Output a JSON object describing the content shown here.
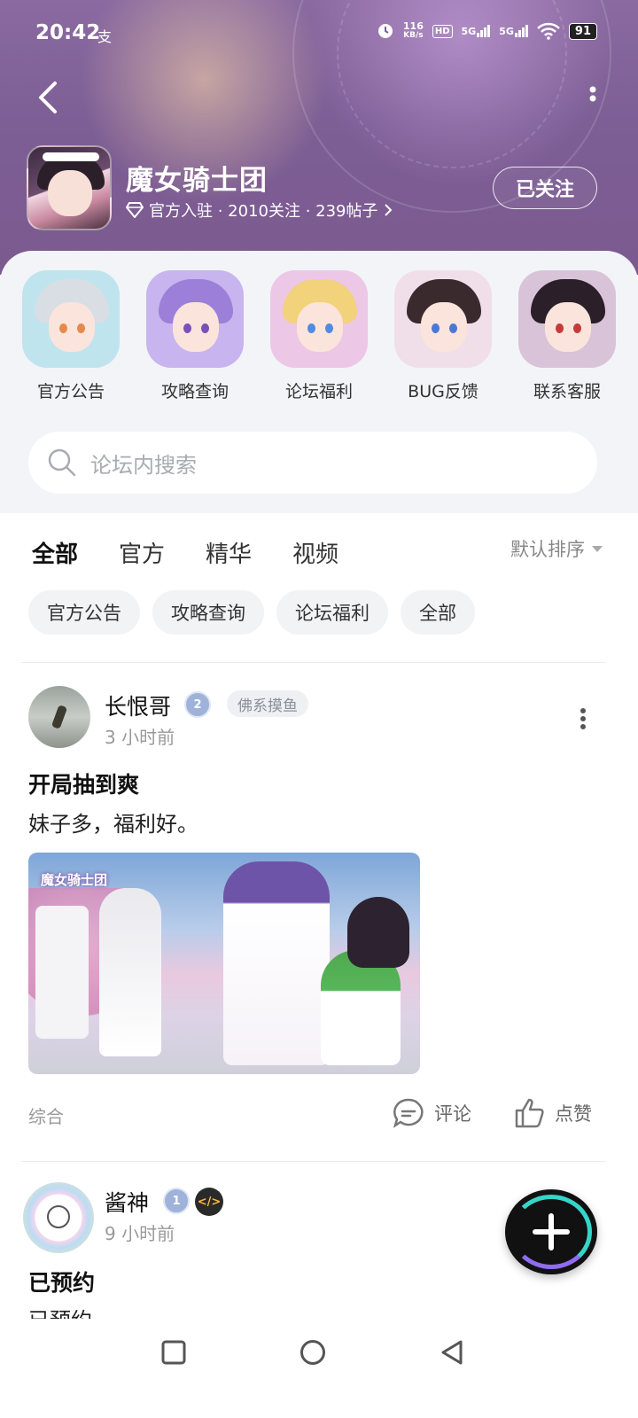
{
  "status_bar": {
    "time": "20:42",
    "extra": "支",
    "speed_value": "116",
    "speed_unit": "KB/s",
    "hd_label": "HD",
    "net1": "5G",
    "net2": "5G",
    "battery": "91"
  },
  "forum": {
    "title": "魔女骑士团",
    "meta": "官方入驻 · 2010关注 · 239帖子",
    "follow_label": "已关注"
  },
  "quick_links": [
    {
      "label": "官方公告",
      "hair": "#d9dde4",
      "bg": "#bfe4ee",
      "eye": "#e58a4c"
    },
    {
      "label": "攻略查询",
      "hair": "#9b7fd8",
      "bg": "#c8b4ee",
      "eye": "#7a4fb8"
    },
    {
      "label": "论坛福利",
      "hair": "#f2d27a",
      "bg": "#ecc7e6",
      "eye": "#4f8be0"
    },
    {
      "label": "BUG反馈",
      "hair": "#3a2a2e",
      "bg": "#f0dfe8",
      "eye": "#4b78d6"
    },
    {
      "label": "联系客服",
      "hair": "#2b1f2a",
      "bg": "#d9c3d8",
      "eye": "#c53a3a"
    }
  ],
  "search": {
    "placeholder": "论坛内搜索"
  },
  "tabs": [
    "全部",
    "官方",
    "精华",
    "视频"
  ],
  "sort_label": "默认排序",
  "chips": [
    "官方公告",
    "攻略查询",
    "论坛福利",
    "全部"
  ],
  "posts": [
    {
      "author": "长恨哥",
      "level": "2",
      "tag": "佛系摸鱼",
      "time": "3 小时前",
      "title": "开局抽到爽",
      "body": "妹子多，福利好。",
      "image_caption": "魔女骑士团",
      "category": "综合",
      "comment_label": "评论",
      "like_label": "点赞"
    },
    {
      "author": "酱神",
      "level": "1",
      "time": "9 小时前",
      "title": "已预约",
      "body": "已预约"
    }
  ],
  "colors": {
    "accent": "#35c9c0",
    "header_bg": "#7d5e95"
  }
}
